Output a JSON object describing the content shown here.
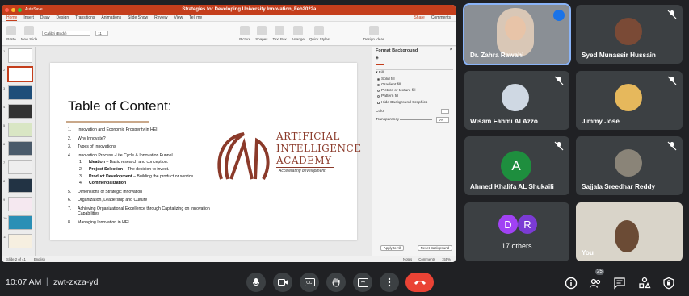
{
  "ppt": {
    "window_title": "Strategies for Developing University Innovation_Feb2022a",
    "autosave": "AutoSave",
    "share": "Share",
    "comments": "Comments",
    "menu": [
      "Home",
      "Insert",
      "Draw",
      "Design",
      "Transitions",
      "Animations",
      "Slide Show",
      "Review",
      "View",
      "Tell me"
    ],
    "ribbon": {
      "paste": "Paste",
      "new_slide": "New Slide",
      "font": "Calibri (Body)",
      "size": "11",
      "picture": "Picture",
      "shapes": "Shapes",
      "text_box": "Text Box",
      "arrange": "Arrange",
      "quick_styles": "Quick Styles",
      "design_ideas": "Design Ideas"
    },
    "slide": {
      "title": "Table of Content:",
      "items": [
        "Innovation and Economic Prosperity in HEI",
        "Why Innovate?",
        "Types of Innovations",
        "Innovation Process -Life Cycle & Innovation Funnel",
        "Dimensions of Strategic Innovation",
        "Organization, Leadership and Culture",
        "Achieving Organizational Excellence through Capitalizing on Innovation Capabilities",
        "Managing Innovation in HEI"
      ],
      "nums": [
        "1.",
        "2.",
        "3.",
        "4.",
        "5.",
        "6.",
        "7.",
        "8."
      ],
      "sub_items": [
        {
          "num": "1.",
          "bold": "Ideation",
          "rest": " – Basic research and conception."
        },
        {
          "num": "2.",
          "bold": "Project Selection",
          "rest": " – The decision to invest."
        },
        {
          "num": "3.",
          "bold": "Product Development",
          "rest": " – Building the product or service"
        },
        {
          "num": "4.",
          "bold": "Commercialization",
          "rest": ""
        }
      ],
      "logo": {
        "line1": "ARTIFICIAL",
        "line2": "INTELLIGENCE",
        "line3": "ACADEMY",
        "tagline": "Accelerating development"
      }
    },
    "format_pane": {
      "title": "Format Background",
      "section": "Fill",
      "options": [
        "Solid fill",
        "Gradient fill",
        "Picture or texture fill",
        "Pattern fill"
      ],
      "hide_graphics": "Hide Background Graphics",
      "color": "Color",
      "transparency": "Transparency",
      "transparency_value": "0%",
      "apply_all": "Apply to All",
      "reset": "Reset Background"
    },
    "status": {
      "slide": "Slide 2 of 41",
      "lang": "English",
      "notes": "Notes",
      "comments": "Comments",
      "zoom": "155%"
    }
  },
  "participants": [
    {
      "name": "Dr. Zahra Rawahi",
      "muted": false,
      "speaking": true
    },
    {
      "name": "Syed Munassir Hussain",
      "muted": true
    },
    {
      "name": "Wisam Fahmi Al Azzo",
      "muted": true
    },
    {
      "name": "Jimmy Jose",
      "muted": true
    },
    {
      "name": "Ahmed Khalifa AL Shukaili",
      "muted": true,
      "initial": "A",
      "color": "#1e8e3e"
    },
    {
      "name": "Sajjala Sreedhar Reddy",
      "muted": true
    },
    {
      "name": "17 others",
      "initials": [
        "D",
        "R"
      ],
      "colors": [
        "#a142f4",
        "#a142f4"
      ]
    },
    {
      "name": "You"
    }
  ],
  "bottom_bar": {
    "time": "10:07 AM",
    "separator": "|",
    "meeting_code": "zwt-zxza-ydj",
    "people_count": "25"
  }
}
